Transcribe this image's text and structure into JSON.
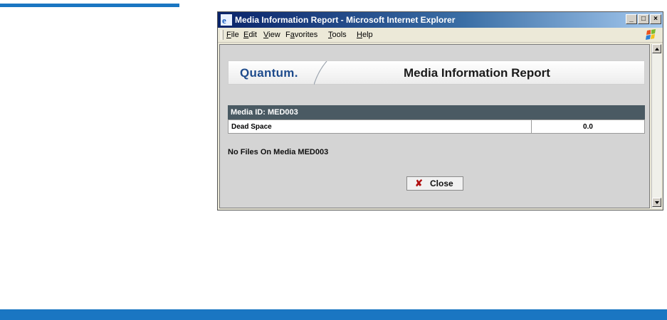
{
  "window": {
    "title": "Media Information Report - Microsoft Internet Explorer",
    "controls": {
      "minimize": "_",
      "maximize": "□",
      "close": "×"
    }
  },
  "menu": {
    "items": [
      {
        "label": "File",
        "key": "F"
      },
      {
        "label": "Edit",
        "key": "E"
      },
      {
        "label": "View",
        "key": "V"
      },
      {
        "label": "Favorites",
        "key": "a"
      },
      {
        "label": "Tools",
        "key": "T"
      },
      {
        "label": "Help",
        "key": "H"
      }
    ]
  },
  "report": {
    "brand": "Quantum.",
    "title": "Media Information Report",
    "media_header": "Media ID: MED003",
    "rows": [
      {
        "label": "Dead Space",
        "value": "0.0"
      }
    ],
    "no_files_message": "No Files On Media MED003",
    "close_label": "Close"
  },
  "colors": {
    "accent_blue": "#1a76c2",
    "table_header": "#4a5a63",
    "brand_blue": "#1e4b8c",
    "close_x": "#b01010"
  },
  "icons": [
    "ie-icon",
    "windows-xp-logo-icon",
    "close-x-icon",
    "scroll-up-icon",
    "scroll-down-icon"
  ]
}
